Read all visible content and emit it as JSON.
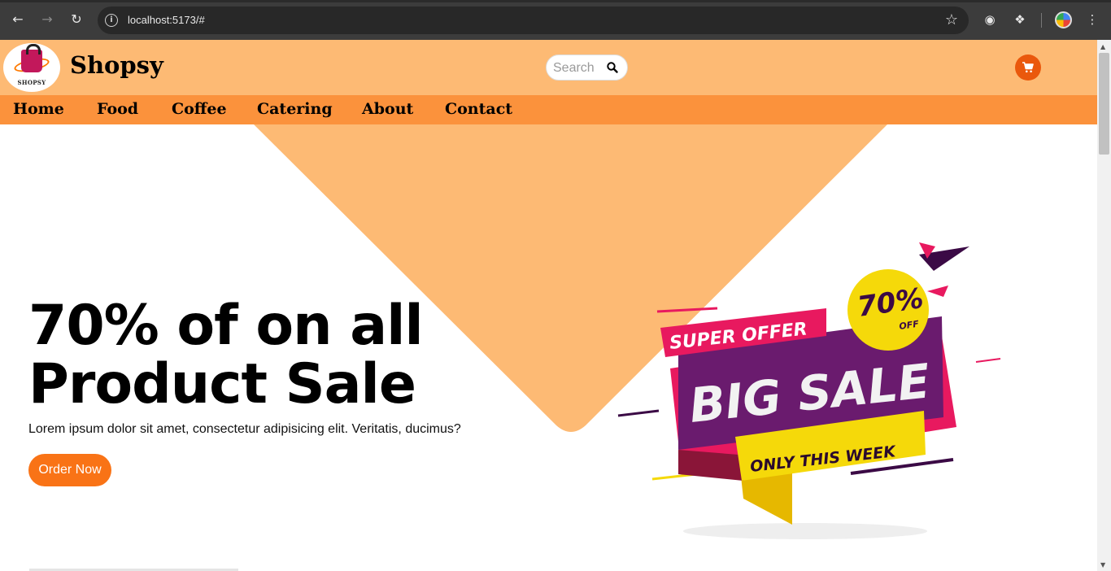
{
  "browser": {
    "url": "localhost:5173/#"
  },
  "header": {
    "brand": "Shopsy",
    "logo_text": "SHOPSY",
    "search_placeholder": "Search"
  },
  "nav": {
    "items": [
      "Home",
      "Food",
      "Coffee",
      "Catering",
      "About",
      "Contact"
    ]
  },
  "hero": {
    "title_line1": "70% of on all",
    "title_line2": "Product Sale",
    "description": "Lorem ipsum dolor sit amet, consectetur adipisicing elit. Veritatis, ducimus?",
    "cta_label": "Order Now"
  },
  "sale_graphic": {
    "super_offer": "SUPER OFFER",
    "big_sale": "BIG SALE",
    "only_this_week": "ONLY THIS WEEK",
    "badge_percent": "70%",
    "badge_off": "OFF"
  },
  "colors": {
    "header_bg": "#fdba74",
    "menu_bg": "#fb923c",
    "accent": "#f97316",
    "cart": "#ea580c"
  }
}
